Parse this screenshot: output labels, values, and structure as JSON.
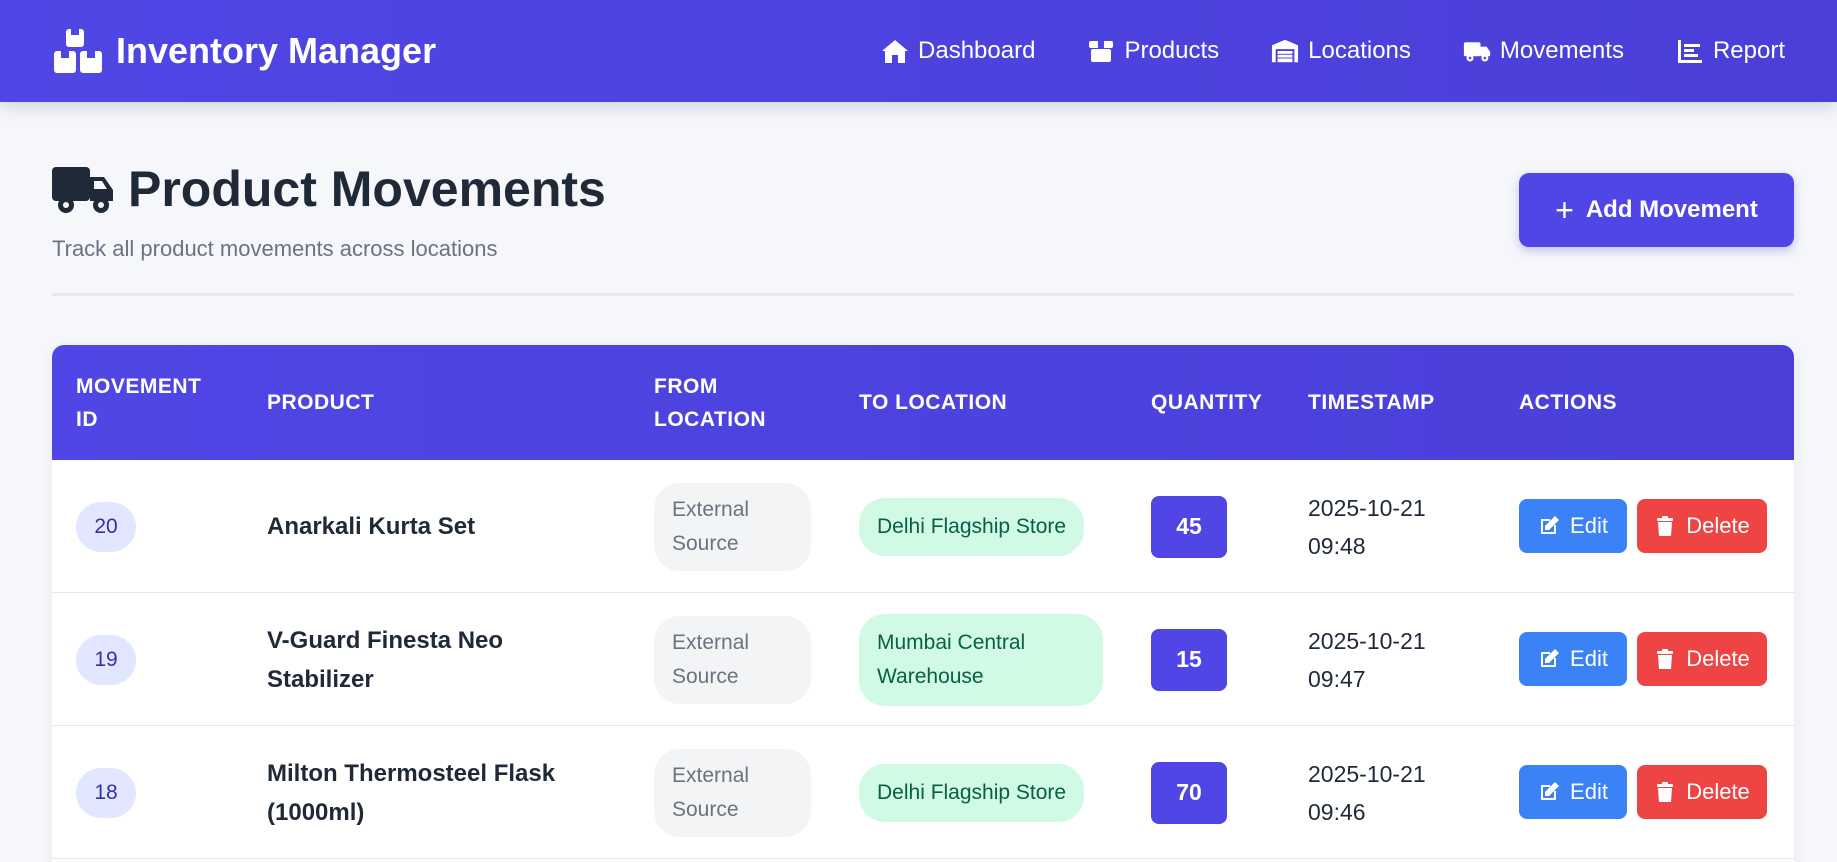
{
  "app": {
    "brand": "Inventory Manager"
  },
  "nav": [
    {
      "label": "Dashboard",
      "icon": "home-icon"
    },
    {
      "label": "Products",
      "icon": "box-icon"
    },
    {
      "label": "Locations",
      "icon": "warehouse-icon"
    },
    {
      "label": "Movements",
      "icon": "truck-icon"
    },
    {
      "label": "Report",
      "icon": "chart-icon"
    }
  ],
  "page": {
    "title": "Product Movements",
    "subtitle": "Track all product movements across locations",
    "add_button": "Add Movement"
  },
  "table": {
    "headers": [
      "MOVEMENT ID",
      "PRODUCT",
      "FROM LOCATION",
      "TO LOCATION",
      "QUANTITY",
      "TIMESTAMP",
      "ACTIONS"
    ],
    "rows": [
      {
        "id": "20",
        "product": "Anarkali Kurta Set",
        "from": "External Source",
        "to": "Delhi Flagship Store",
        "quantity": "45",
        "timestamp": "2025-10-21 09:48"
      },
      {
        "id": "19",
        "product": "V-Guard Finesta Neo Stabilizer",
        "from": "External Source",
        "to": "Mumbai Central Warehouse",
        "quantity": "15",
        "timestamp": "2025-10-21 09:47"
      },
      {
        "id": "18",
        "product": "Milton Thermosteel Flask (1000ml)",
        "from": "External Source",
        "to": "Delhi Flagship Store",
        "quantity": "70",
        "timestamp": "2025-10-21 09:46"
      }
    ],
    "edit_label": "Edit",
    "delete_label": "Delete"
  },
  "colors": {
    "primary": "#4f46e5",
    "edit": "#3b82f6",
    "delete": "#ef4444",
    "to_badge": "#d1fae5"
  }
}
